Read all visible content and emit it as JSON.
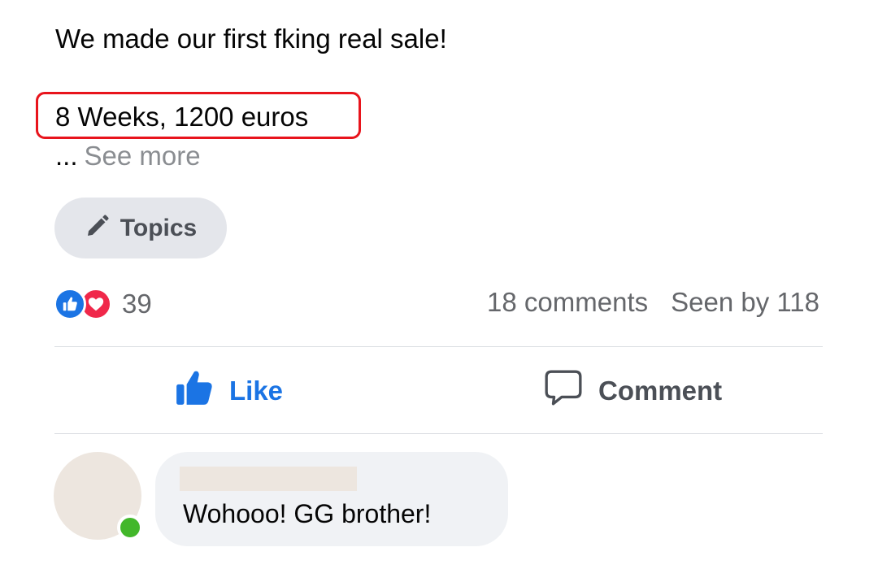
{
  "post": {
    "line1": "We made our first fking  real sale!",
    "line2": "8 Weeks, 1200 euros",
    "ellipsis": "...",
    "see_more": "See more",
    "highlight_color": "#e8141c"
  },
  "topics": {
    "label": "Topics",
    "icon": "pencil-icon"
  },
  "reactions": {
    "icons": [
      "like-reaction-icon",
      "love-reaction-icon"
    ],
    "count": "39",
    "like_color": "#1b74e4",
    "love_color": "#f0284a"
  },
  "stats": {
    "comments": "18 comments",
    "seen_by": "Seen by 118"
  },
  "actions": {
    "like_label": "Like",
    "comment_label": "Comment",
    "like_color": "#1b74e4"
  },
  "comment": {
    "text": "Wohooo! GG brother!",
    "online_color": "#42b72a"
  }
}
